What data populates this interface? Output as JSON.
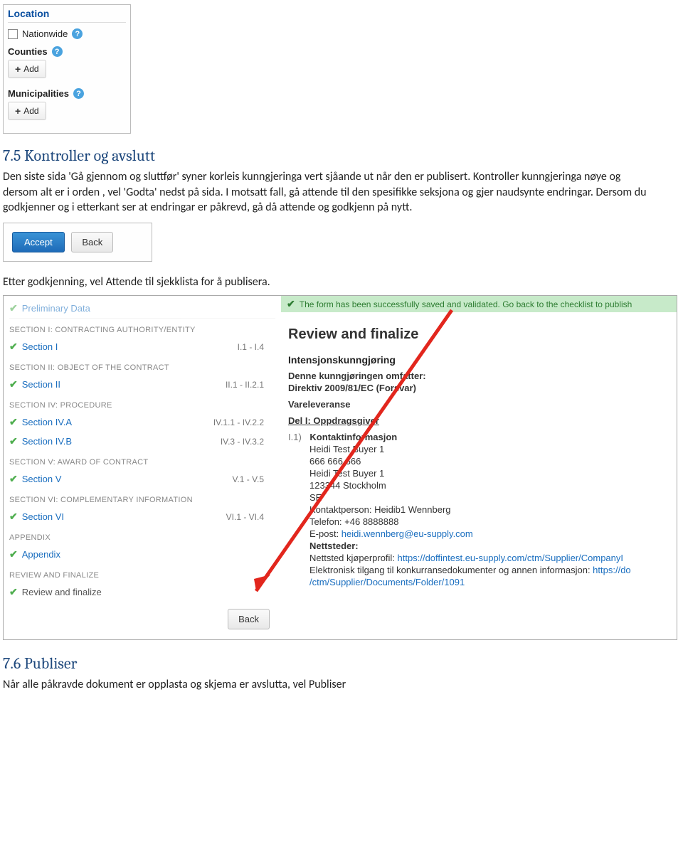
{
  "locationPanel": {
    "header": "Location",
    "nationwide": "Nationwide",
    "counties": "Counties",
    "municipalities": "Municipalities",
    "add": "Add",
    "help": "?"
  },
  "sec75": {
    "heading": "7.5 Kontroller og avslutt",
    "p1": "Den siste sida 'Gå gjennom og sluttfør' syner korleis kunngjeringa vert sjåande ut når den er publisert. Kontroller kunngjeringa nøye og dersom alt er i orden , vel 'Godta' nedst på sida. I motsatt fall, gå attende til den spesifikke seksjona og gjer naudsynte endringar. Dersom du godkjenner og i etterkant ser at endringar er påkrevd, gå då attende og godkjenn på nytt.",
    "accept": "Accept",
    "back": "Back",
    "p2": "Etter godkjenning, vel Attende til sjekklista for å publisera."
  },
  "checklist": {
    "statusbar": "The form has been successfully saved and validated. Go back to the checklist to publish",
    "prelim": "Preliminary Data",
    "cat1": "SECTION I: CONTRACTING AUTHORITY/ENTITY",
    "s1": "Section I",
    "r1": "I.1 - I.4",
    "cat2": "SECTION II: OBJECT OF THE CONTRACT",
    "s2": "Section II",
    "r2": "II.1 - II.2.1",
    "cat4": "SECTION IV: PROCEDURE",
    "s4a": "Section IV.A",
    "r4a": "IV.1.1 - IV.2.2",
    "s4b": "Section IV.B",
    "r4b": "IV.3 - IV.3.2",
    "cat5": "SECTION V: AWARD OF CONTRACT",
    "s5": "Section V",
    "r5": "V.1 - V.5",
    "cat6": "SECTION VI: COMPLEMENTARY INFORMATION",
    "s6": "Section VI",
    "r6": "VI.1 - VI.4",
    "catApp": "APPENDIX",
    "appendix": "Appendix",
    "catRev": "REVIEW AND FINALIZE",
    "review": "Review and finalize",
    "back": "Back"
  },
  "detail": {
    "heading": "Review and finalize",
    "title": "Intensjonskunngjøring",
    "sub1": "Denne kunngjøringen omfatter:",
    "sub2": "Direktiv 2009/81/EC (Forsvar)",
    "vare": "Vareleveranse",
    "del": "Del I: Oppdragsgiver",
    "i1": "I.1)",
    "kontakt": "Kontaktinformasjon",
    "l1": "Heidi Test Buyer 1",
    "l2": "666 666 666",
    "l3": "Heidi Test Buyer 1",
    "l4": "123344 Stockholm",
    "l5": "SE",
    "l6a": "Kontaktperson: ",
    "l6b": "Heidib1 Wennberg",
    "l7a": "Telefon: ",
    "l7b": "+46 8888888",
    "l8a": "E-post: ",
    "l8b": "heidi.wennberg@eu-supply.com",
    "nett": "Nettsteder:",
    "n1a": "Nettsted kjøperprofil: ",
    "n1b": "https://doffintest.eu-supply.com/ctm/Supplier/CompanyI",
    "n2a": "Elektronisk tilgang til konkurransedokumenter og annen informasjon: ",
    "n2b": "https://do",
    "n3": "/ctm/Supplier/Documents/Folder/1091"
  },
  "sec76": {
    "heading": "7.6 Publiser",
    "p1": "Når alle påkravde dokument er opplasta og skjema er avslutta, vel Publiser"
  }
}
